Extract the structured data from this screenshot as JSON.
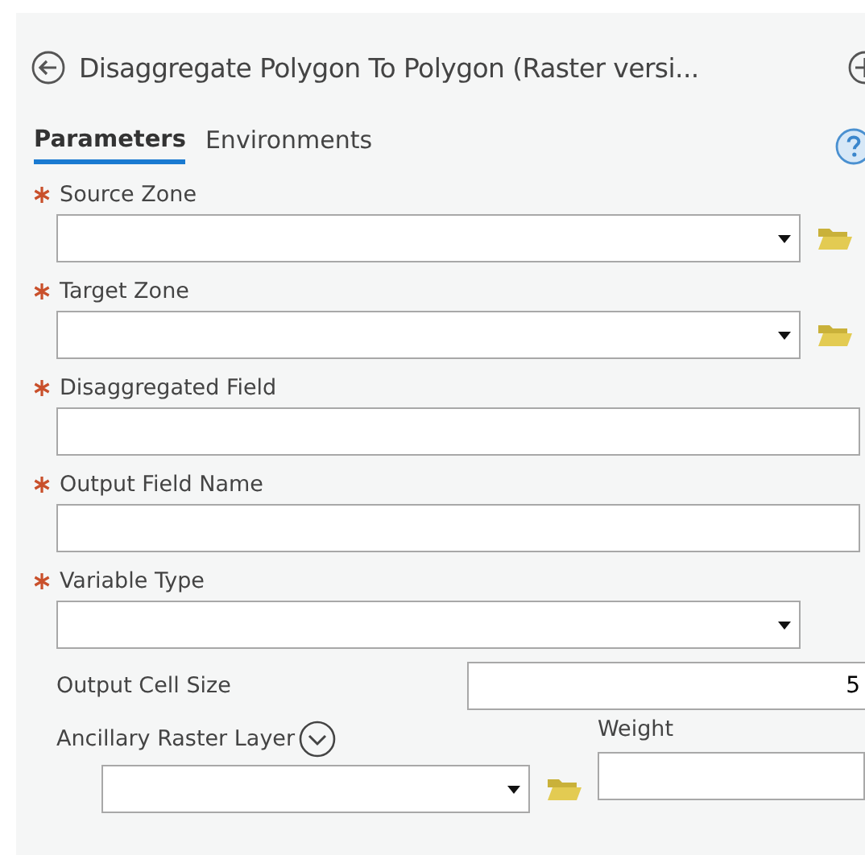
{
  "title": "Disaggregate Polygon To Polygon (Raster versi...",
  "tabs": [
    {
      "label": "Parameters",
      "selected": true
    },
    {
      "label": "Environments",
      "selected": false
    }
  ],
  "parameters": [
    {
      "label": "Source Zone",
      "required": true,
      "kind": "dropdown_browse"
    },
    {
      "label": "Target Zone",
      "required": true,
      "kind": "dropdown_browse"
    },
    {
      "label": "Disaggregated Field",
      "required": true,
      "kind": "text"
    },
    {
      "label": "Output Field Name",
      "required": true,
      "kind": "text"
    },
    {
      "label": "Variable Type",
      "required": true,
      "kind": "dropdown"
    },
    {
      "label": "Output Cell Size",
      "required": false,
      "kind": "inline",
      "value": "5"
    }
  ],
  "ancillary": {
    "label": "Ancillary Raster Layer",
    "weight_label": "Weight",
    "expanded": false
  }
}
